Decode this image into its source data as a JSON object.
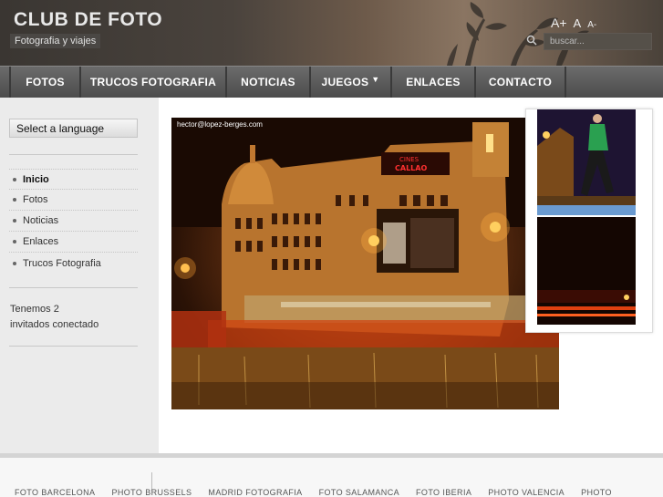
{
  "header": {
    "title": "CLUB DE FOTO",
    "subtitle": "Fotografia y viajes",
    "font_controls": [
      "A+",
      "A",
      "A-"
    ],
    "search": {
      "placeholder": "buscar...",
      "icon": "search-icon"
    }
  },
  "nav": {
    "items": [
      {
        "label": "FOTOS"
      },
      {
        "label": "TRUCOS FOTOGRAFIA"
      },
      {
        "label": "NOTICIAS"
      },
      {
        "label": "JUEGOS",
        "has_dropdown": true
      },
      {
        "label": "ENLACES"
      },
      {
        "label": "CONTACTO"
      }
    ]
  },
  "sidebar": {
    "language_select": "Select a language",
    "menu": [
      {
        "label": "Inicio",
        "active": true
      },
      {
        "label": "Fotos"
      },
      {
        "label": "Noticias"
      },
      {
        "label": "Enlaces"
      },
      {
        "label": "Trucos Fotografia"
      }
    ],
    "online_line1": "Tenemos 2",
    "online_line2": "invitados conectado"
  },
  "main": {
    "photo_credit": "hector@lopez-berges.com",
    "sign_text_1": "CINES",
    "sign_text_2": "CALLAO"
  },
  "footer": {
    "links": [
      "FOTO BARCELONA",
      "PHOTO BRUSSELS",
      "MADRID FOTOGRAFIA",
      "FOTO SALAMANCA",
      "FOTO IBERIA",
      "PHOTO VALENCIA",
      "PHOTO"
    ]
  },
  "colors": {
    "nav_bg": "#5a5a5a",
    "sidebar_bg": "#ebebeb",
    "header_text": "#e8e8e8"
  }
}
